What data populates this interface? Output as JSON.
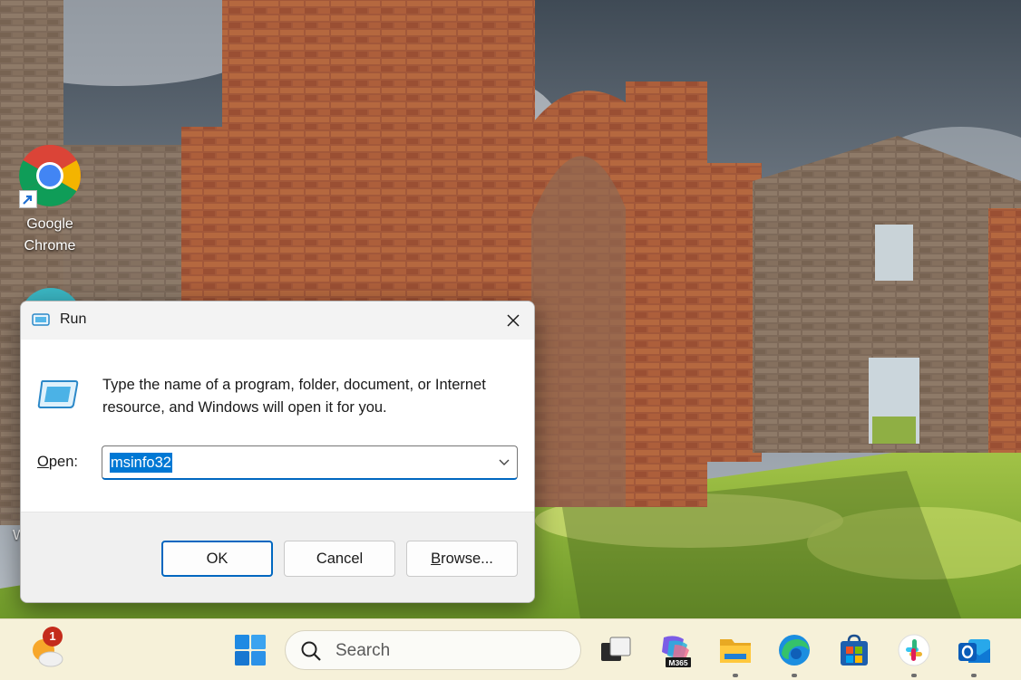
{
  "desktop": {
    "chrome_label_line1": "Google",
    "chrome_label_line2": "Chrome",
    "edge_letter": "W"
  },
  "run_dialog": {
    "title": "Run",
    "instructions": "Type the name of a program, folder, document, or Internet resource, and Windows will open it for you.",
    "open_label_accesskey": "O",
    "open_label_rest": "pen:",
    "open_value": "msinfo32",
    "buttons": {
      "ok": "OK",
      "cancel": "Cancel",
      "browse_accesskey": "B",
      "browse_rest": "rowse..."
    }
  },
  "taskbar": {
    "weather_badge": "1",
    "search_placeholder": "Search",
    "m365_badge": "M365",
    "colors": {
      "background": "#f6f1d9",
      "accent": "#0067c0"
    },
    "apps": [
      "start-icon",
      "task-view-icon",
      "m365-copilot-icon",
      "file-explorer-icon",
      "edge-icon",
      "store-icon",
      "slack-icon",
      "outlook-icon"
    ]
  }
}
